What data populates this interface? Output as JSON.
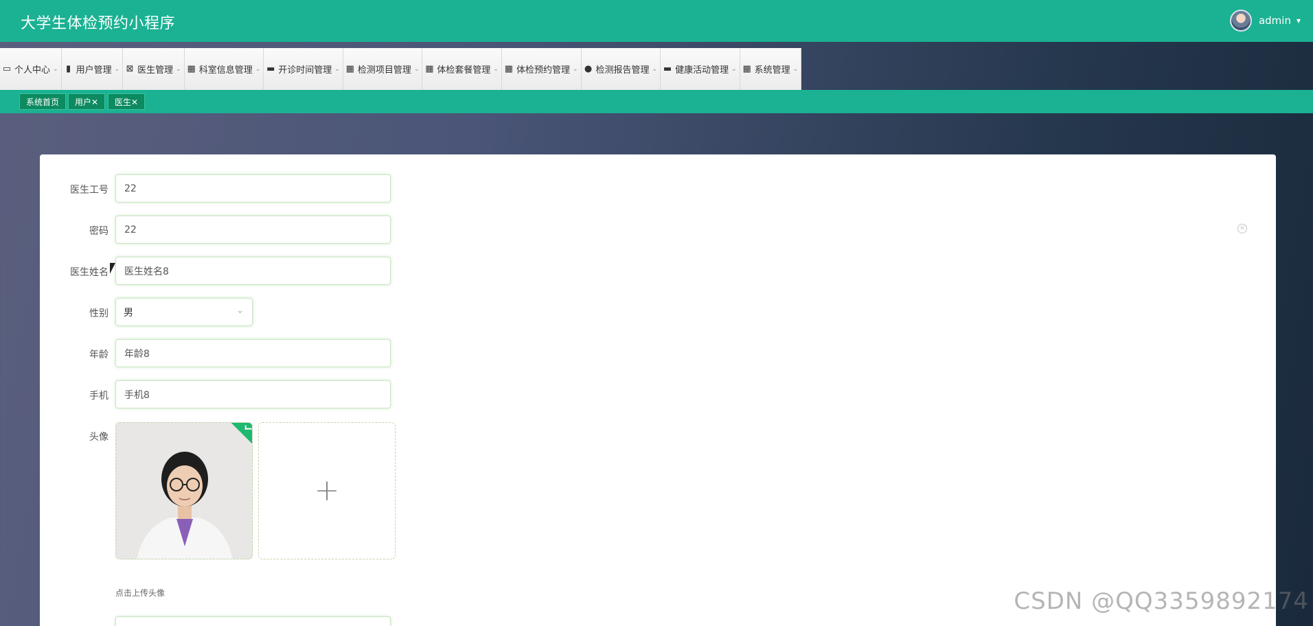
{
  "header": {
    "app_title": "大学生体检预约小程序",
    "username": "admin",
    "caret_glyph": "▾"
  },
  "nav": {
    "items": [
      {
        "icon": "calendar-icon",
        "glyph": "▭",
        "label": "个人中心"
      },
      {
        "icon": "user-icon",
        "glyph": "▮",
        "label": "用户管理"
      },
      {
        "icon": "clipboard-icon",
        "glyph": "⊠",
        "label": "医生管理"
      },
      {
        "icon": "grid-icon",
        "glyph": "▦",
        "label": "科室信息管理"
      },
      {
        "icon": "chat-icon",
        "glyph": "▬",
        "label": "开诊时间管理"
      },
      {
        "icon": "grid-icon",
        "glyph": "▦",
        "label": "检测项目管理"
      },
      {
        "icon": "grid-icon",
        "glyph": "▦",
        "label": "体检套餐管理"
      },
      {
        "icon": "grid-icon",
        "glyph": "▦",
        "label": "体检预约管理"
      },
      {
        "icon": "person-icon",
        "glyph": "●",
        "label": "检测报告管理"
      },
      {
        "icon": "folder-icon",
        "glyph": "▬",
        "label": "健康活动管理"
      },
      {
        "icon": "grid-icon",
        "glyph": "▦",
        "label": "系统管理"
      }
    ],
    "chevron_glyph": "⌄"
  },
  "tags": [
    {
      "label": "系统首页"
    },
    {
      "label": "用户✕"
    },
    {
      "label": "医生✕"
    }
  ],
  "form": {
    "doctor_id": {
      "label": "医生工号",
      "value": "22"
    },
    "password": {
      "label": "密码",
      "value": "22"
    },
    "doctor_name": {
      "label": "医生姓名",
      "value": "医生姓名8"
    },
    "gender": {
      "label": "性别",
      "value": "男"
    },
    "age": {
      "label": "年龄",
      "value": "年龄8"
    },
    "phone": {
      "label": "手机",
      "value": "手机8"
    },
    "avatar": {
      "label": "头像",
      "hint": "点击上传头像",
      "plus_glyph": "+"
    },
    "clear_glyph": "✕"
  },
  "watermark": "CSDN @QQ3359892174",
  "colors": {
    "header_bg": "#1bb193",
    "tag_bg": "#0d8a60",
    "upload_success": "#1eb96e"
  }
}
